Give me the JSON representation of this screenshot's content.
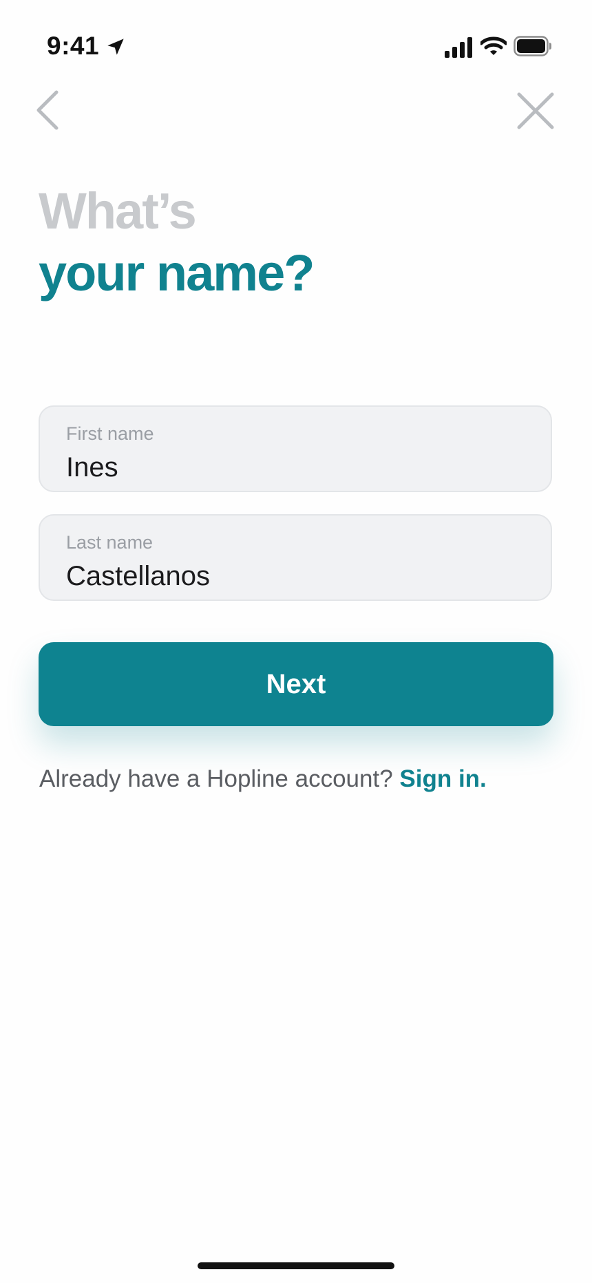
{
  "status_bar": {
    "time": "9:41",
    "icons": [
      "location-arrow-icon",
      "cellular-signal-icon",
      "wifi-icon",
      "battery-icon"
    ]
  },
  "nav": {
    "back_icon": "chevron-left-icon",
    "close_icon": "close-icon"
  },
  "heading": {
    "line1": "What’s",
    "line2": "your name?"
  },
  "form": {
    "first_name": {
      "label": "First name",
      "value": "Ines"
    },
    "last_name": {
      "label": "Last name",
      "value": "Castellanos"
    }
  },
  "next_button": {
    "label": "Next"
  },
  "signin": {
    "prompt": "Already have a Hopline account?",
    "link": "Sign in."
  },
  "colors": {
    "accent": "#0e8390",
    "heading_muted": "#c8cacd",
    "field_bg": "#f1f2f4",
    "icon_gray": "#b9bcc0"
  }
}
